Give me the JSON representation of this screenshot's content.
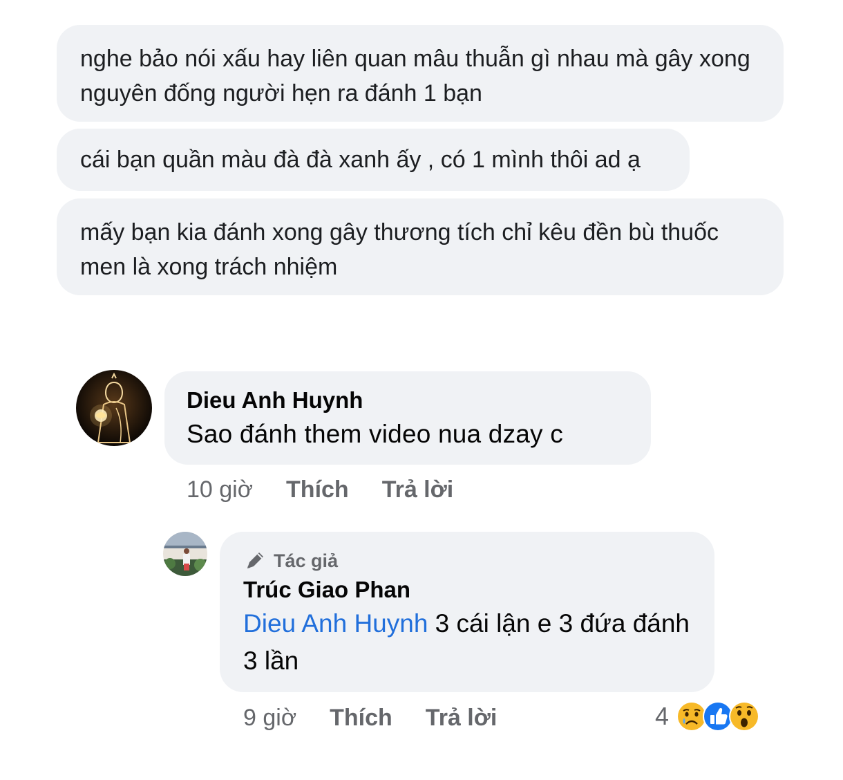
{
  "messages": [
    {
      "text": "nghe bảo nói xấu hay liên quan mâu thuẫn gì nhau mà gây xong nguyên đống người hẹn ra đánh 1 bạn"
    },
    {
      "text": "cái bạn quần màu đà đà xanh ấy , có 1 mình thôi ad ạ"
    },
    {
      "text": "mấy bạn kia đánh xong gây thương tích chỉ kêu đền bù thuốc men là xong trách nhiệm"
    }
  ],
  "comment": {
    "author": "Dieu Anh Huynh",
    "text": "Sao đánh them video nua dzay c",
    "time": "10 giờ",
    "like_label": "Thích",
    "reply_label": "Trả lời",
    "avatar_icon": "glowing-figure-avatar"
  },
  "reply": {
    "badge_label": "Tác giả",
    "badge_icon": "pen-icon",
    "author": "Trúc Giao Phan",
    "mention": "Dieu Anh Huynh",
    "text": " 3 cái lận e 3 đứa đánh 3 lần",
    "time": "9 giờ",
    "like_label": "Thích",
    "reply_label": "Trả lời",
    "reaction_count": "4",
    "reactions": [
      "sad-icon",
      "like-icon",
      "wow-icon"
    ],
    "avatar_icon": "person-photo-avatar"
  },
  "colors": {
    "bubble": "#f0f2f5",
    "secondary_text": "#65676b",
    "mention": "#216fdb",
    "like_blue": "#1877f2",
    "reaction_yellow": "#f7b928"
  }
}
